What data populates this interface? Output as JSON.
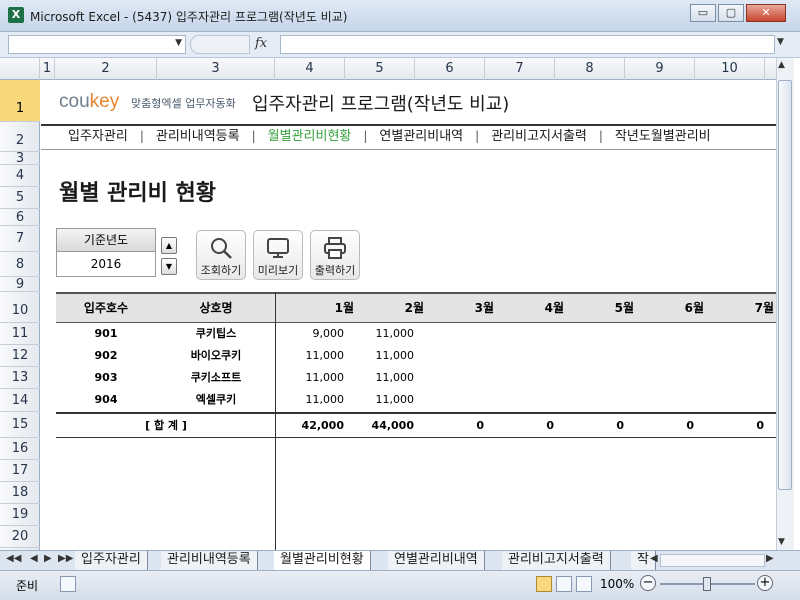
{
  "window": {
    "app_icon": "X",
    "title": "Microsoft Excel - (5437) 입주자관리 프로그램(작년도 비교)",
    "minimize": "▭",
    "restore": "▢",
    "close": "✕"
  },
  "formula_bar": {
    "name_box": "",
    "fx_label": "fx",
    "formula": ""
  },
  "columns": [
    "1",
    "2",
    "3",
    "4",
    "5",
    "6",
    "7",
    "8",
    "9",
    "10"
  ],
  "rows": [
    "1",
    "2",
    "3",
    "4",
    "5",
    "6",
    "7",
    "8",
    "9",
    "10",
    "11",
    "12",
    "13",
    "14",
    "15",
    "16",
    "17",
    "18",
    "19",
    "20"
  ],
  "header": {
    "logo_main": "cou",
    "logo_accent": "key",
    "logo_sub": "맞춤형엑셀 업무자동화",
    "app_title": "입주자관리 프로그램(작년도 비교)"
  },
  "nav": {
    "items": [
      "입주자관리",
      "관리비내역등록",
      "월별관리비현황",
      "연별관리비내역",
      "관리비고지서출력",
      "작년도월별관리비"
    ],
    "separator": "|",
    "active_index": 2
  },
  "page": {
    "heading": "월별 관리비 현황",
    "year_label": "기준년도",
    "year_value": "2016",
    "spin_up": "▲",
    "spin_down": "▼",
    "buttons": {
      "search": "조회하기",
      "preview": "미리보기",
      "print": "출력하기"
    }
  },
  "table": {
    "headers": [
      "입주호수",
      "상호명",
      "1월",
      "2월",
      "3월",
      "4월",
      "5월",
      "6월",
      "7월"
    ],
    "rows": [
      {
        "unit": "901",
        "name": "쿠키팁스",
        "m1": "9,000",
        "m2": "11,000"
      },
      {
        "unit": "902",
        "name": "바이오쿠키",
        "m1": "11,000",
        "m2": "11,000"
      },
      {
        "unit": "903",
        "name": "쿠키소프트",
        "m1": "11,000",
        "m2": "11,000"
      },
      {
        "unit": "904",
        "name": "엑셀쿠키",
        "m1": "11,000",
        "m2": "11,000"
      }
    ],
    "total": {
      "label": "[ 합   계 ]",
      "values": [
        "42,000",
        "44,000",
        "0",
        "0",
        "0",
        "0",
        "0"
      ]
    }
  },
  "sheet_tabs": {
    "nav_first": "◀◀",
    "nav_prev": "◀",
    "nav_next": "▶",
    "nav_last": "▶▶",
    "tabs": [
      "입주자관리",
      "관리비내역등록",
      "월별관리비현황",
      "연별관리비내역",
      "관리비고지서출력",
      "작"
    ],
    "active_index": 2
  },
  "status": {
    "ready": "준비",
    "zoom": "100%",
    "zoom_out": "−",
    "zoom_in": "+"
  }
}
